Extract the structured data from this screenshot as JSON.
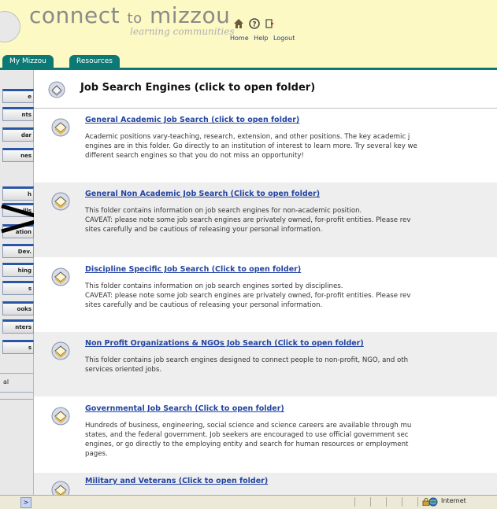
{
  "header": {
    "logo_text": "connect",
    "logo_to": "to",
    "logo_end": "mizzou",
    "tagline": "learning communities",
    "links": [
      "Home",
      "Help",
      "Logout"
    ]
  },
  "tabs": [
    "My Mizzou",
    "Resources"
  ],
  "sidebar": {
    "buttons": [
      "e",
      "nts",
      "dar",
      "nes",
      "h",
      "ills",
      "ation",
      "Dev.",
      "hing",
      "s",
      "ooks",
      "nters",
      "s"
    ],
    "link": "al"
  },
  "page": {
    "title": "Job Search Engines (click to open folder)"
  },
  "entries": [
    {
      "title": "General Academic Job Search (click to open folder)",
      "lines": [
        "Academic positions vary-teaching, research, extension, and other positions. The key academic j",
        "engines are in this folder. Go directly to an institution of interest to learn more. Try several key we",
        "different search engines so that you do not miss an opportunity!"
      ]
    },
    {
      "title": "General Non Academic Job Search (Click to open folder)",
      "lines": [
        "This folder contains information on job search engines for non-academic position.",
        "CAVEAT: please note some job search engines are privately owned, for-profit entities. Please rev",
        "sites carefully and be cautious of releasing your personal information."
      ]
    },
    {
      "title": "Discipline Specific Job Search (Click to open folder)",
      "lines": [
        "This folder contains information on job search engines sorted by disciplines.",
        "CAVEAT: please note some job search engines are privately owned, for-profit entities. Please rev",
        "sites carefully and be cautious of releasing your personal information."
      ]
    },
    {
      "title": "Non Profit Organizations & NGOs Job Search (Click to open folder)",
      "lines": [
        "This folder contains job search engines designed to connect people to non-profit, NGO, and oth",
        "services oriented jobs."
      ]
    },
    {
      "title": "Governmental Job Search (Click to open folder)",
      "lines": [
        "Hundreds of business, engineering, social science and science careers are available through mu",
        "states, and the federal government. Job seekers are encouraged to use official government sec",
        "engines, or go directly to the employing entity and search for human resources or employment",
        "pages."
      ]
    },
    {
      "title": "Military and Veterans (Click to open folder)",
      "lines": []
    }
  ],
  "statusbar": {
    "zone": "Internet",
    "scroll_glyph": ">"
  }
}
